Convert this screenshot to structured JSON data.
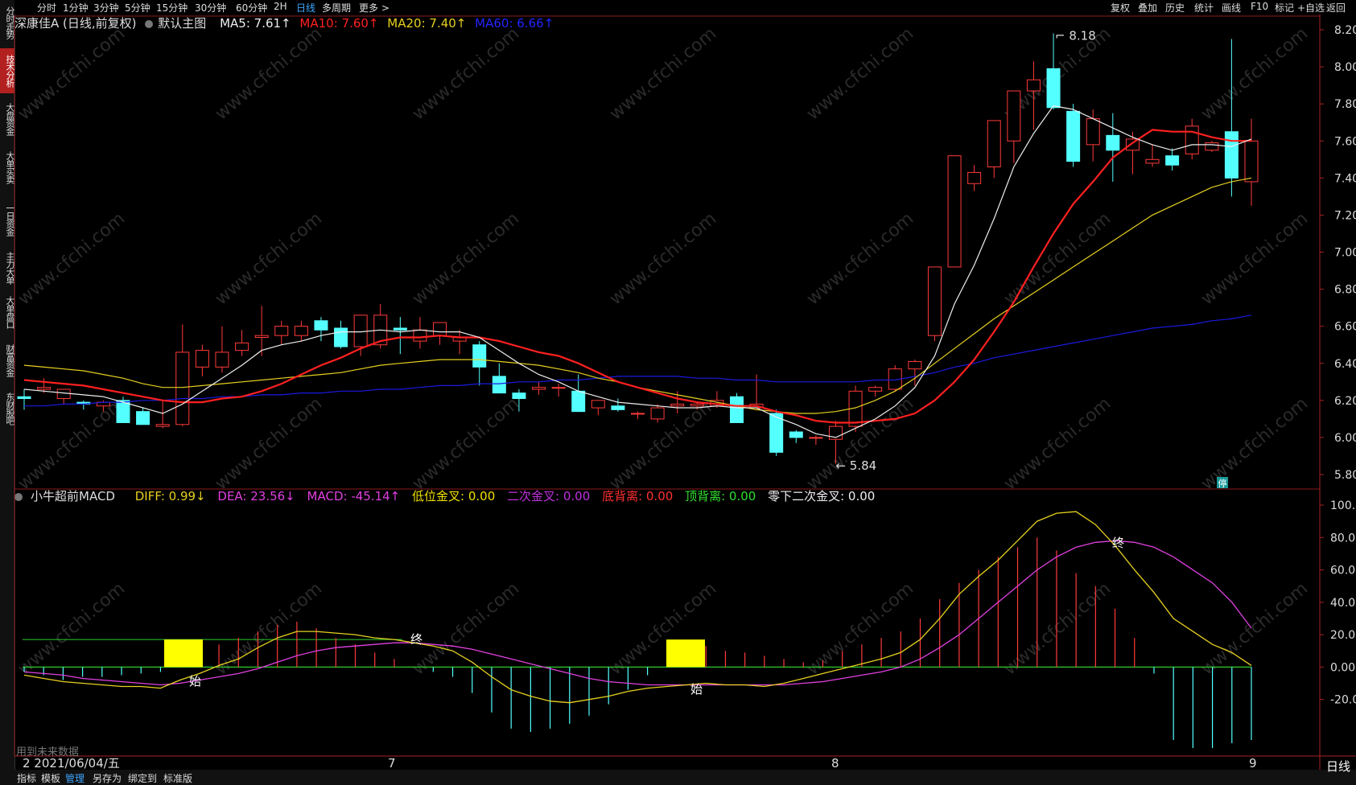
{
  "left_tabs": [
    {
      "label": "分时走势",
      "active": false
    },
    {
      "label": "技术分析",
      "active": true
    },
    {
      "label": "大盘资金",
      "active": false
    },
    {
      "label": "大单买卖",
      "active": false
    },
    {
      "label": "一日资金",
      "active": false
    },
    {
      "label": "主力大单",
      "active": false
    },
    {
      "label": "大单盘口",
      "active": false
    },
    {
      "label": "财富资金",
      "active": false
    },
    {
      "label": "东财股吧",
      "active": false
    }
  ],
  "timeframes": [
    "分时",
    "1分钟",
    "3分钟",
    "5分钟",
    "15分钟",
    "30分钟",
    "60分钟",
    "2H",
    "日线",
    "多周期",
    "更多 >"
  ],
  "active_timeframe": "日线",
  "right_tools": [
    "复权",
    "叠加",
    "历史",
    "统计",
    "画线",
    "F10",
    "标记",
    "+自选",
    "返回"
  ],
  "info": {
    "stock": "深康佳A (日线,前复权)",
    "main": "默认主图",
    "ma5": "MA5: 7.61↑",
    "ma10": "MA10: 7.60↑",
    "ma20": "MA20: 7.40↑",
    "ma60": "MA60: 6.66↑"
  },
  "macd_info": {
    "name": "小牛超前MACD",
    "diff": "DIFF: 0.99↓",
    "dea": "DEA: 23.56↓",
    "macd": "MACD: -45.14↑",
    "low_cross": "低位金叉: 0.00",
    "second_cross": "二次金叉: 0.00",
    "bottom_div": "底背离: 0.00",
    "top_div": "顶背离: 0.00",
    "zero_second": "零下二次金叉: 0.00"
  },
  "colors": {
    "up": "#ff3a3a",
    "down": "#54ffff",
    "ma5": "#eeeeee",
    "ma10": "#ff2020",
    "ma20": "#e6d020",
    "ma60": "#1a1ae0",
    "diff": "#e6d020",
    "dea": "#e040e0",
    "zero": "#2ecc2e"
  },
  "price_axis": [
    "8.20",
    "8.00",
    "7.80",
    "7.60",
    "7.40",
    "7.20",
    "7.00",
    "6.80",
    "6.60",
    "6.40",
    "6.20",
    "6.00",
    "5.80"
  ],
  "macd_axis": [
    "100.00",
    "80.00",
    "60.00",
    "40.00",
    "20.00",
    "0.00",
    "-20.00"
  ],
  "x_labels": [
    "2021/06/04/五",
    "7",
    "8",
    "9"
  ],
  "x_prefix": "2",
  "annotations": {
    "high": "8.18",
    "low": "5.84",
    "start": "始",
    "end": "终",
    "stop": "停",
    "future": "用到未来数据"
  },
  "bottom_tabs": [
    "指标",
    "模板",
    "管理",
    "另存为",
    "绑定到",
    "标准版"
  ],
  "active_bottom_tab": "管理",
  "period_label": "日线",
  "chart_data": [
    {
      "type": "candlestick",
      "title": "深康佳A (日线,前复权)",
      "ylim": [
        5.8,
        8.2
      ],
      "candles": [
        [
          6.22,
          6.26,
          6.15,
          6.21
        ],
        [
          6.26,
          6.32,
          6.24,
          6.27
        ],
        [
          6.21,
          6.25,
          6.18,
          6.26
        ],
        [
          6.19,
          6.2,
          6.15,
          6.18
        ],
        [
          6.17,
          6.2,
          6.14,
          6.19
        ],
        [
          6.2,
          6.22,
          6.08,
          6.08
        ],
        [
          6.14,
          6.16,
          6.07,
          6.07
        ],
        [
          6.06,
          6.2,
          6.05,
          6.07
        ],
        [
          6.07,
          6.61,
          6.06,
          6.46
        ],
        [
          6.38,
          6.5,
          6.33,
          6.47
        ],
        [
          6.38,
          6.6,
          6.35,
          6.46
        ],
        [
          6.47,
          6.58,
          6.44,
          6.51
        ],
        [
          6.54,
          6.71,
          6.44,
          6.55
        ],
        [
          6.55,
          6.63,
          6.5,
          6.6
        ],
        [
          6.55,
          6.63,
          6.52,
          6.6
        ],
        [
          6.63,
          6.65,
          6.52,
          6.58
        ],
        [
          6.59,
          6.63,
          6.48,
          6.49
        ],
        [
          6.49,
          6.66,
          6.44,
          6.66
        ],
        [
          6.5,
          6.72,
          6.48,
          6.66
        ],
        [
          6.59,
          6.65,
          6.45,
          6.58
        ],
        [
          6.52,
          6.65,
          6.48,
          6.58
        ],
        [
          6.55,
          6.62,
          6.5,
          6.62
        ],
        [
          6.52,
          6.58,
          6.45,
          6.54
        ],
        [
          6.5,
          6.52,
          6.28,
          6.38
        ],
        [
          6.33,
          6.4,
          6.26,
          6.24
        ],
        [
          6.24,
          6.26,
          6.14,
          6.21
        ],
        [
          6.26,
          6.3,
          6.23,
          6.27
        ],
        [
          6.27,
          6.29,
          6.22,
          6.27
        ],
        [
          6.25,
          6.34,
          6.14,
          6.14
        ],
        [
          6.16,
          6.2,
          6.12,
          6.2
        ],
        [
          6.17,
          6.21,
          6.14,
          6.15
        ],
        [
          6.13,
          6.14,
          6.1,
          6.13
        ],
        [
          6.1,
          6.18,
          6.08,
          6.16
        ],
        [
          6.17,
          6.25,
          6.13,
          6.18
        ],
        [
          6.17,
          6.19,
          6.15,
          6.18
        ],
        [
          6.17,
          6.25,
          6.16,
          6.2
        ],
        [
          6.22,
          6.24,
          6.08,
          6.08
        ],
        [
          6.16,
          6.34,
          6.15,
          6.18
        ],
        [
          6.13,
          6.15,
          5.9,
          5.92
        ],
        [
          6.03,
          6.04,
          5.97,
          6.0
        ],
        [
          6.0,
          6.01,
          5.96,
          6.0
        ],
        [
          5.99,
          6.09,
          5.86,
          6.06
        ],
        [
          6.06,
          6.28,
          6.03,
          6.25
        ],
        [
          6.25,
          6.28,
          6.22,
          6.27
        ],
        [
          6.26,
          6.39,
          6.25,
          6.37
        ],
        [
          6.37,
          6.42,
          6.28,
          6.41
        ],
        [
          6.55,
          6.92,
          6.52,
          6.92
        ],
        [
          6.92,
          7.52,
          6.92,
          7.52
        ],
        [
          7.37,
          7.47,
          7.33,
          7.43
        ],
        [
          7.46,
          7.71,
          7.4,
          7.71
        ],
        [
          7.6,
          7.87,
          7.48,
          7.87
        ],
        [
          7.87,
          8.03,
          7.66,
          7.93
        ],
        [
          7.99,
          8.18,
          7.77,
          7.78
        ],
        [
          7.76,
          7.8,
          7.46,
          7.49
        ],
        [
          7.58,
          7.77,
          7.49,
          7.72
        ],
        [
          7.63,
          7.75,
          7.38,
          7.55
        ],
        [
          7.55,
          7.65,
          7.42,
          7.61
        ],
        [
          7.48,
          7.58,
          7.46,
          7.5
        ],
        [
          7.52,
          7.56,
          7.44,
          7.47
        ],
        [
          7.53,
          7.72,
          7.5,
          7.68
        ],
        [
          7.55,
          7.6,
          7.54,
          7.59
        ],
        [
          7.65,
          8.15,
          7.3,
          7.4
        ],
        [
          7.38,
          7.72,
          7.25,
          7.6
        ]
      ],
      "ma5": [
        6.26,
        6.25,
        6.24,
        6.23,
        6.22,
        6.19,
        6.16,
        6.13,
        6.18,
        6.25,
        6.32,
        6.39,
        6.47,
        6.5,
        6.52,
        6.55,
        6.57,
        6.57,
        6.58,
        6.57,
        6.58,
        6.57,
        6.57,
        6.54,
        6.47,
        6.4,
        6.34,
        6.3,
        6.25,
        6.22,
        6.19,
        6.18,
        6.17,
        6.16,
        6.16,
        6.17,
        6.16,
        6.16,
        6.11,
        6.07,
        6.02,
        6.0,
        6.05,
        6.1,
        6.17,
        6.27,
        6.44,
        6.72,
        6.93,
        7.18,
        7.46,
        7.64,
        7.79,
        7.77,
        7.72,
        7.67,
        7.62,
        7.58,
        7.55,
        7.58,
        7.58,
        7.57,
        7.61
      ],
      "ma10": [
        6.31,
        6.3,
        6.29,
        6.28,
        6.26,
        6.24,
        6.22,
        6.2,
        6.19,
        6.19,
        6.21,
        6.22,
        6.25,
        6.29,
        6.34,
        6.39,
        6.43,
        6.48,
        6.52,
        6.54,
        6.54,
        6.55,
        6.54,
        6.54,
        6.52,
        6.49,
        6.46,
        6.44,
        6.4,
        6.35,
        6.3,
        6.27,
        6.24,
        6.21,
        6.19,
        6.18,
        6.17,
        6.17,
        6.14,
        6.12,
        6.09,
        6.08,
        6.08,
        6.09,
        6.1,
        6.13,
        6.2,
        6.3,
        6.42,
        6.57,
        6.73,
        6.92,
        7.1,
        7.26,
        7.38,
        7.51,
        7.59,
        7.66,
        7.65,
        7.65,
        7.62,
        7.6,
        7.6
      ],
      "ma20": [
        6.39,
        6.38,
        6.37,
        6.36,
        6.34,
        6.32,
        6.29,
        6.27,
        6.27,
        6.28,
        6.29,
        6.3,
        6.31,
        6.32,
        6.33,
        6.34,
        6.35,
        6.37,
        6.39,
        6.4,
        6.41,
        6.42,
        6.42,
        6.42,
        6.41,
        6.4,
        6.39,
        6.37,
        6.35,
        6.32,
        6.3,
        6.27,
        6.25,
        6.23,
        6.21,
        6.19,
        6.17,
        6.15,
        6.14,
        6.13,
        6.13,
        6.14,
        6.16,
        6.2,
        6.25,
        6.32,
        6.4,
        6.48,
        6.56,
        6.64,
        6.71,
        6.78,
        6.85,
        6.92,
        6.99,
        7.06,
        7.13,
        7.2,
        7.25,
        7.3,
        7.35,
        7.38,
        7.4
      ],
      "ma60": [
        6.17,
        6.17,
        6.18,
        6.18,
        6.19,
        6.19,
        6.2,
        6.2,
        6.21,
        6.21,
        6.22,
        6.22,
        6.23,
        6.23,
        6.24,
        6.24,
        6.25,
        6.25,
        6.26,
        6.26,
        6.27,
        6.28,
        6.28,
        6.29,
        6.29,
        6.3,
        6.3,
        6.31,
        6.31,
        6.32,
        6.33,
        6.33,
        6.33,
        6.33,
        6.32,
        6.32,
        6.31,
        6.31,
        6.3,
        6.3,
        6.3,
        6.3,
        6.3,
        6.31,
        6.31,
        6.33,
        6.35,
        6.38,
        6.4,
        6.43,
        6.45,
        6.47,
        6.49,
        6.51,
        6.53,
        6.55,
        6.57,
        6.59,
        6.6,
        6.61,
        6.63,
        6.64,
        6.66
      ]
    },
    {
      "type": "macd",
      "title": "小牛超前MACD",
      "ylim": [
        -45,
        100
      ],
      "diff": [
        -5,
        -7,
        -9,
        -10,
        -11,
        -12,
        -12,
        -13,
        -8,
        -4,
        1,
        5,
        12,
        18,
        22,
        22,
        21,
        20,
        18,
        17,
        15,
        13,
        10,
        3,
        -6,
        -14,
        -18,
        -21,
        -22,
        -20,
        -18,
        -15,
        -13,
        -12,
        -11,
        -10,
        -11,
        -11,
        -12,
        -10,
        -7,
        -4,
        -1,
        2,
        5,
        9,
        17,
        30,
        45,
        56,
        66,
        78,
        90,
        95,
        96,
        88,
        75,
        60,
        46,
        30,
        22,
        14,
        9,
        1
      ],
      "dea": [
        -3,
        -4,
        -5,
        -7,
        -8,
        -9,
        -10,
        -11,
        -10,
        -8,
        -6,
        -4,
        -1,
        3,
        7,
        10,
        12,
        13,
        14,
        15,
        15,
        14,
        13,
        11,
        8,
        5,
        2,
        -1,
        -4,
        -7,
        -9,
        -10,
        -11,
        -11,
        -11,
        -11,
        -11,
        -11,
        -11,
        -11,
        -10,
        -9,
        -7,
        -5,
        -3,
        0,
        5,
        12,
        20,
        30,
        40,
        50,
        60,
        68,
        74,
        77,
        78,
        77,
        74,
        68,
        60,
        52,
        40,
        24
      ],
      "hist": [
        -3,
        -5,
        -8,
        -6,
        -6,
        -5,
        -4,
        -3,
        4,
        8,
        14,
        18,
        22,
        26,
        28,
        24,
        18,
        14,
        9,
        5,
        0,
        -3,
        -6,
        -16,
        -28,
        -38,
        -40,
        -38,
        -35,
        -30,
        -23,
        -14,
        -5,
        3,
        9,
        13,
        10,
        9,
        7,
        5,
        3,
        4,
        10,
        14,
        18,
        22,
        30,
        42,
        52,
        60,
        68,
        74,
        80,
        72,
        58,
        50,
        36,
        18,
        -4,
        -45,
        -50,
        -50,
        -47,
        -45
      ],
      "ylabels": [
        "100.00",
        "80.00",
        "60.00",
        "40.00",
        "20.00",
        "0.00",
        "-20.00"
      ]
    }
  ]
}
